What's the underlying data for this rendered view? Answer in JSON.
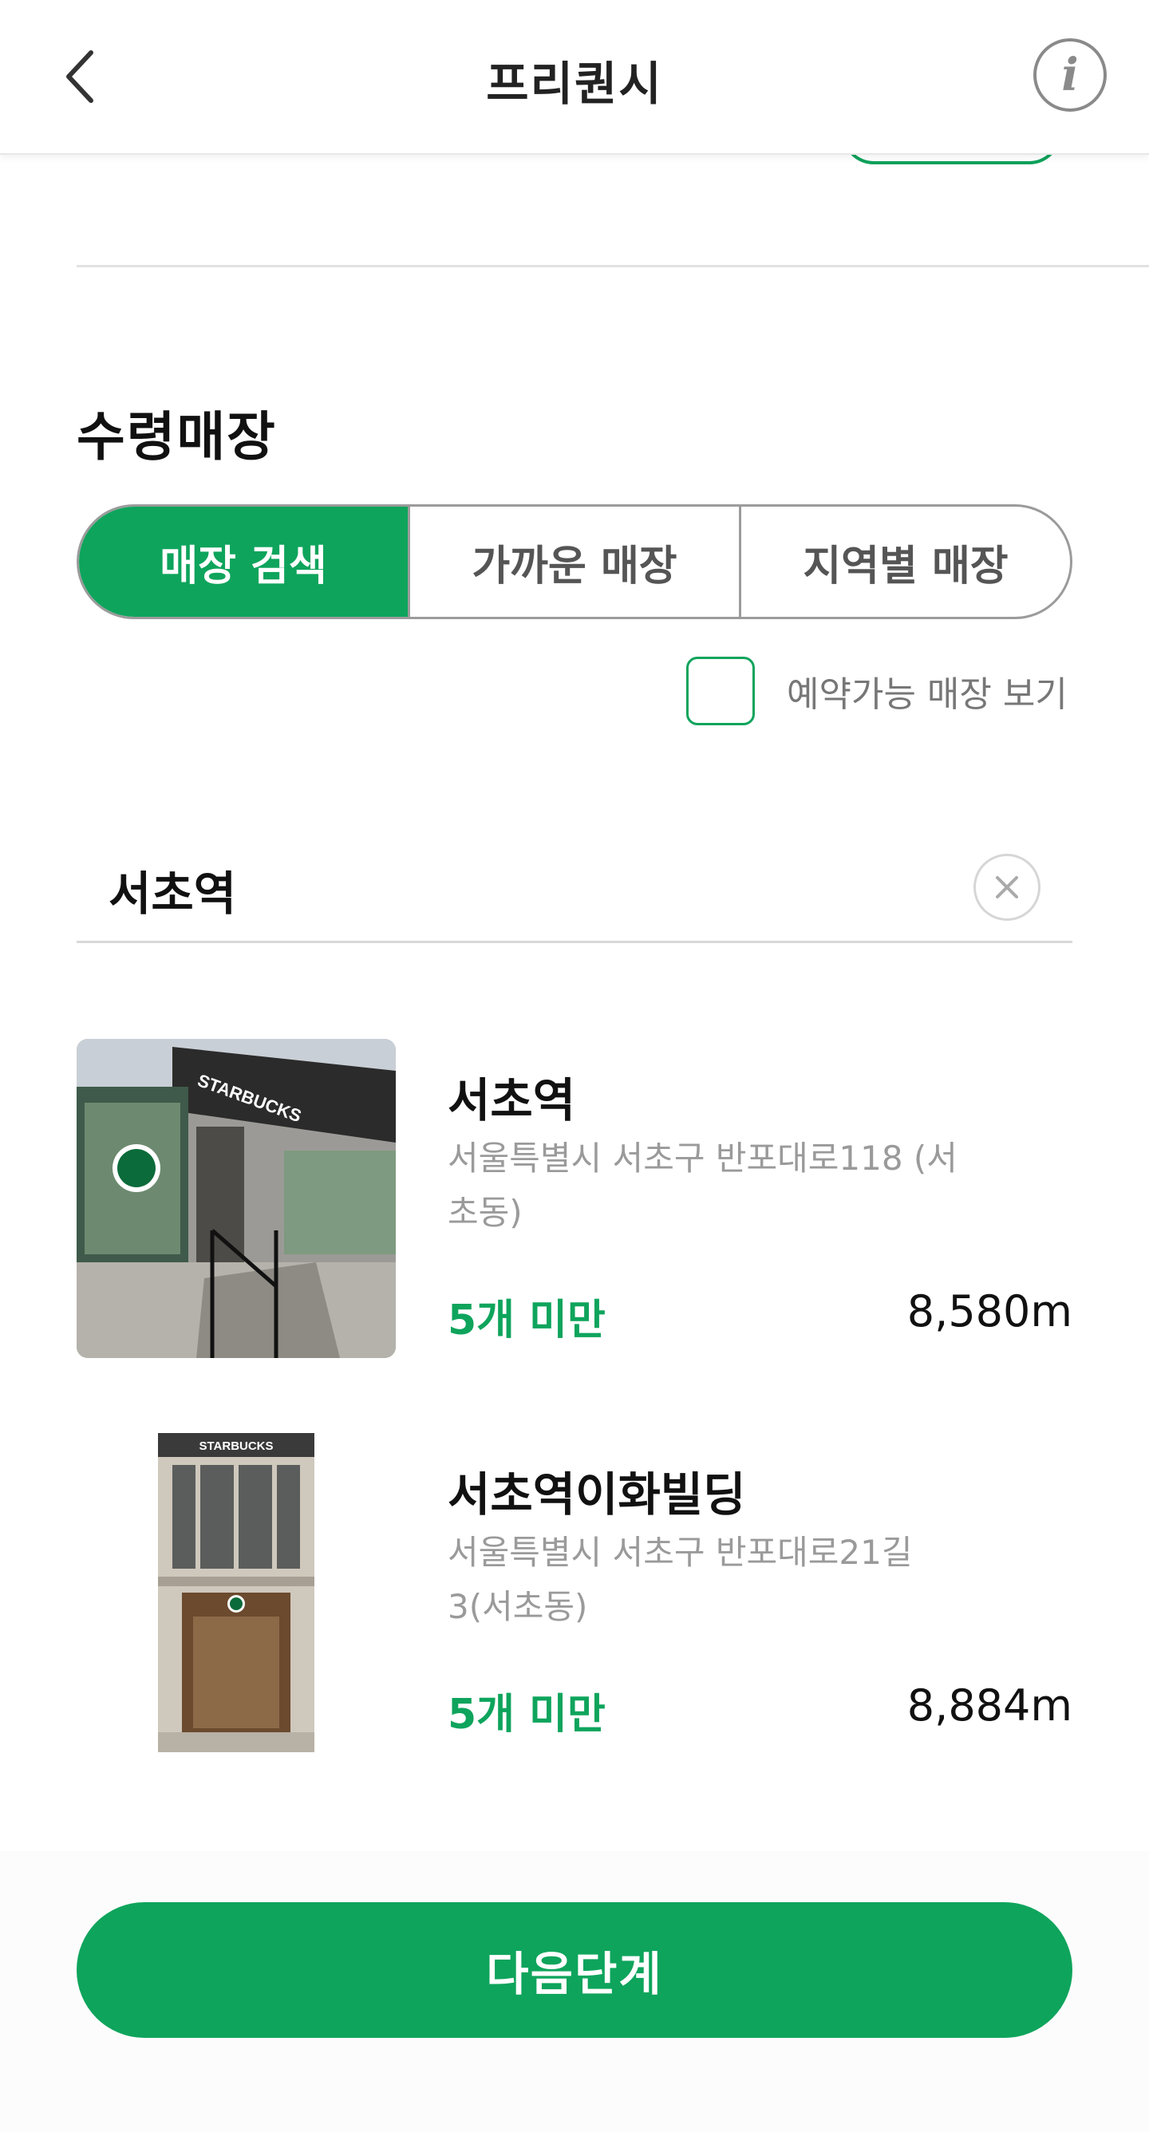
{
  "header": {
    "title": "프리퀀시",
    "back_icon": "chevron-left-icon",
    "info_icon": "info-icon",
    "info_glyph": "i"
  },
  "pickup_store": {
    "section_title": "수령매장",
    "tabs": [
      {
        "label": "매장 검색",
        "active": true
      },
      {
        "label": "가까운 매장",
        "active": false
      },
      {
        "label": "지역별 매장",
        "active": false
      }
    ],
    "reservable_filter": {
      "label": "예약가능 매장 보기",
      "checked": false
    }
  },
  "search": {
    "value": "서초역",
    "clear_icon": "close-circle-icon"
  },
  "stores": [
    {
      "name": "서초역",
      "address": "서울특별시 서초구 반포대로118 (서초동)",
      "stock": "5개 미만",
      "distance": "8,580m"
    },
    {
      "name": "서초역이화빌딩",
      "address": "서울특별시 서초구 반포대로21길 3(서초동)",
      "stock": "5개 미만",
      "distance": "8,884m"
    }
  ],
  "footer": {
    "next_label": "다음단계"
  },
  "colors": {
    "accent": "#0ea45c",
    "muted_text": "#9a9a9a",
    "border": "#9b9b9b"
  }
}
